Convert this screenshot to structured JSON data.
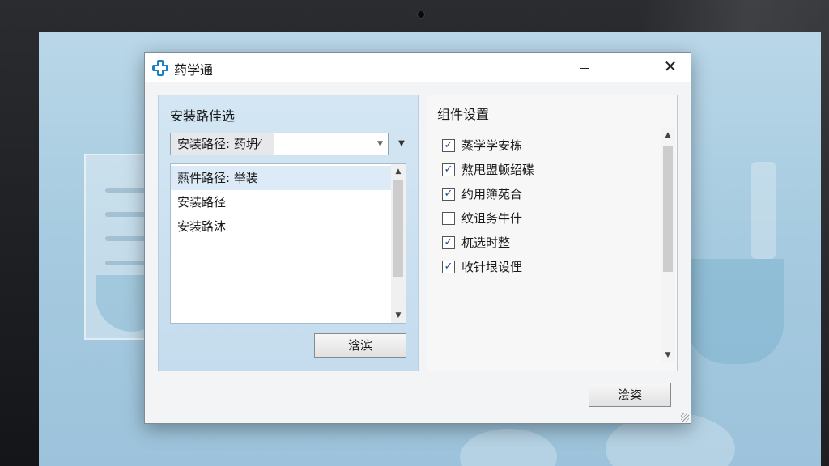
{
  "window": {
    "title": "药学通",
    "icon": "medical-cross-icon",
    "minimize_icon": "minimize-icon",
    "close_label": "X"
  },
  "install_path": {
    "group_title": "安装路佳选",
    "combo_value": "安装路径: 药坍⁄",
    "list_items": [
      {
        "label": "爇件路径: 举装",
        "selected": true
      },
      {
        "label": "安装路径",
        "selected": false
      },
      {
        "label": "安装路沐",
        "selected": false
      }
    ],
    "button_label": "浛滨"
  },
  "components": {
    "group_title": "组件设置",
    "items": [
      {
        "label": "蒸学学安栋",
        "checked": true
      },
      {
        "label": "熬甩盟顿绍碟",
        "checked": true
      },
      {
        "label": "约用簿苑合",
        "checked": true
      },
      {
        "label": "纹诅务牛什",
        "checked": false
      },
      {
        "label": "杌选时整",
        "checked": true
      },
      {
        "label": "收针垠设俚",
        "checked": true
      }
    ]
  },
  "footer": {
    "button_label": "浍粢"
  },
  "colors": {
    "accent": "#1d6fb8",
    "panel_bg": "#c9dfef"
  }
}
